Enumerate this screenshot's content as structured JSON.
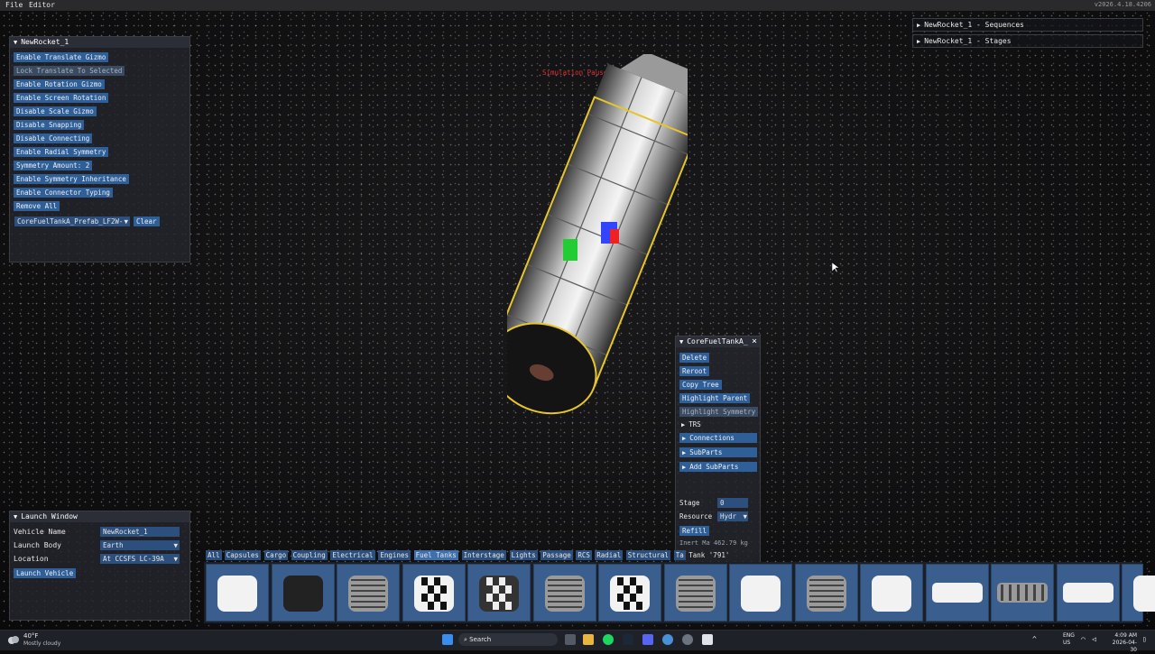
{
  "menu": [
    "File",
    "Editor"
  ],
  "version": "v2026.4.18.4206",
  "sim_status": "Simulation Paused",
  "left_panel": {
    "title": "NewRocket_1",
    "buttons": [
      {
        "label": "Enable Translate Gizmo",
        "dim": false
      },
      {
        "label": "Lock Translate To Selected",
        "dim": true
      },
      {
        "label": "Enable Rotation Gizmo",
        "dim": false
      },
      {
        "label": "Enable Screen Rotation",
        "dim": false
      },
      {
        "label": "Disable Scale Gizmo",
        "dim": false
      },
      {
        "label": "Disable Snapping",
        "dim": false
      },
      {
        "label": "Disable Connecting",
        "dim": false
      },
      {
        "label": "Enable Radial Symmetry",
        "dim": false
      },
      {
        "label": "Symmetry Amount: 2",
        "dim": false
      },
      {
        "label": "Enable Symmetry Inheritance",
        "dim": false
      },
      {
        "label": "Enable Connector Typing",
        "dim": false
      },
      {
        "label": "Remove All",
        "dim": false
      }
    ],
    "prefab_select": "CoreFuelTankA_Prefab_LF2W-",
    "clear_label": "Clear"
  },
  "right_top": {
    "sequences": "NewRocket_1 - Sequences",
    "stages": "NewRocket_1 - Stages"
  },
  "part_panel": {
    "title": "CoreFuelTankA_",
    "close": "×",
    "buttons": [
      {
        "label": "Delete",
        "dim": false
      },
      {
        "label": "Reroot",
        "dim": false
      },
      {
        "label": "Copy Tree",
        "dim": false
      },
      {
        "label": "Highlight Parent",
        "dim": false
      },
      {
        "label": "Highlight Symmetry",
        "dim": true
      }
    ],
    "trs": "TRS",
    "sections": [
      "Connections",
      "SubParts",
      "Add SubParts"
    ],
    "stage_label": "Stage",
    "stage_value": "0",
    "resource_label": "Resource",
    "resource_value": "Hydr",
    "refill": "Refill",
    "inert_label": "Inert Ma",
    "inert_value": "462.79 kg",
    "tank": "Tank '791'"
  },
  "launch": {
    "title": "Launch Window",
    "vehicle_name_label": "Vehicle Name",
    "vehicle_name_value": "NewRocket_1",
    "launch_body_label": "Launch Body",
    "launch_body_value": "Earth",
    "location_label": "Location",
    "location_value": "At CCSFS LC-39A",
    "launch_button": "Launch Vehicle"
  },
  "tabs": [
    {
      "label": "All",
      "active": false
    },
    {
      "label": "Capsules",
      "active": false
    },
    {
      "label": "Cargo",
      "active": false
    },
    {
      "label": "Coupling",
      "active": false
    },
    {
      "label": "Electrical",
      "active": false
    },
    {
      "label": "Engines",
      "active": false
    },
    {
      "label": "Fuel Tanks",
      "active": true
    },
    {
      "label": "Interstage",
      "active": false
    },
    {
      "label": "Lights",
      "active": false
    },
    {
      "label": "Passage",
      "active": false
    },
    {
      "label": "RCS",
      "active": false
    },
    {
      "label": "Radial",
      "active": false
    },
    {
      "label": "Structural",
      "active": false
    },
    {
      "label": "Ta",
      "active": false
    }
  ],
  "parts": [
    "white",
    "black",
    "ribbed",
    "checker",
    "checker-dark",
    "ribbed",
    "checker",
    "ribbed",
    "white",
    "ribbed",
    "white",
    "white-wide",
    "ribbed-wide",
    "white-wide",
    "white"
  ],
  "taskbar": {
    "weather_temp": "40°F",
    "weather_desc": "Mostly cloudy",
    "search": "Search",
    "lang": "ENG",
    "region": "US",
    "time": "4:09 AM",
    "date": "2026-04-30"
  }
}
